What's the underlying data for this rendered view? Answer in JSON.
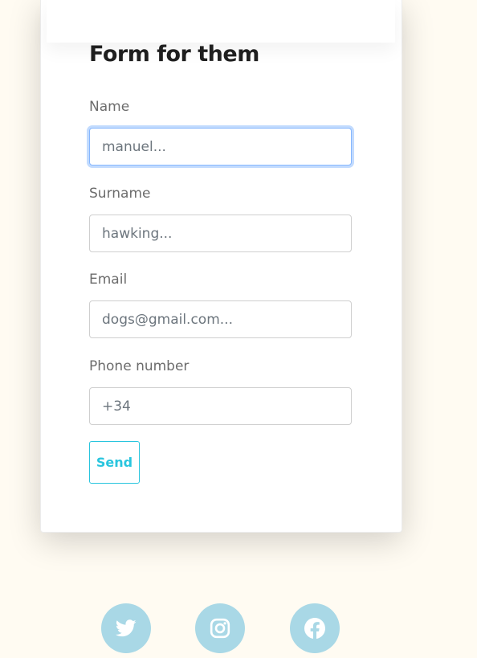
{
  "form": {
    "title": "Form for them",
    "fields": [
      {
        "label": "Name",
        "placeholder": "manuel...",
        "value": ""
      },
      {
        "label": "Surname",
        "placeholder": "hawking...",
        "value": ""
      },
      {
        "label": "Email",
        "placeholder": "dogs@gmail.com...",
        "value": ""
      },
      {
        "label": "Phone number",
        "placeholder": "+34",
        "value": ""
      }
    ],
    "send_label": "Send"
  },
  "colors": {
    "background": "#fffbf2",
    "accent": "#29c5de",
    "focus_ring": "#86b7fe",
    "social_bg": "#a9d8e6"
  },
  "social": [
    {
      "icon": "twitter-icon"
    },
    {
      "icon": "instagram-icon"
    },
    {
      "icon": "facebook-icon"
    }
  ]
}
